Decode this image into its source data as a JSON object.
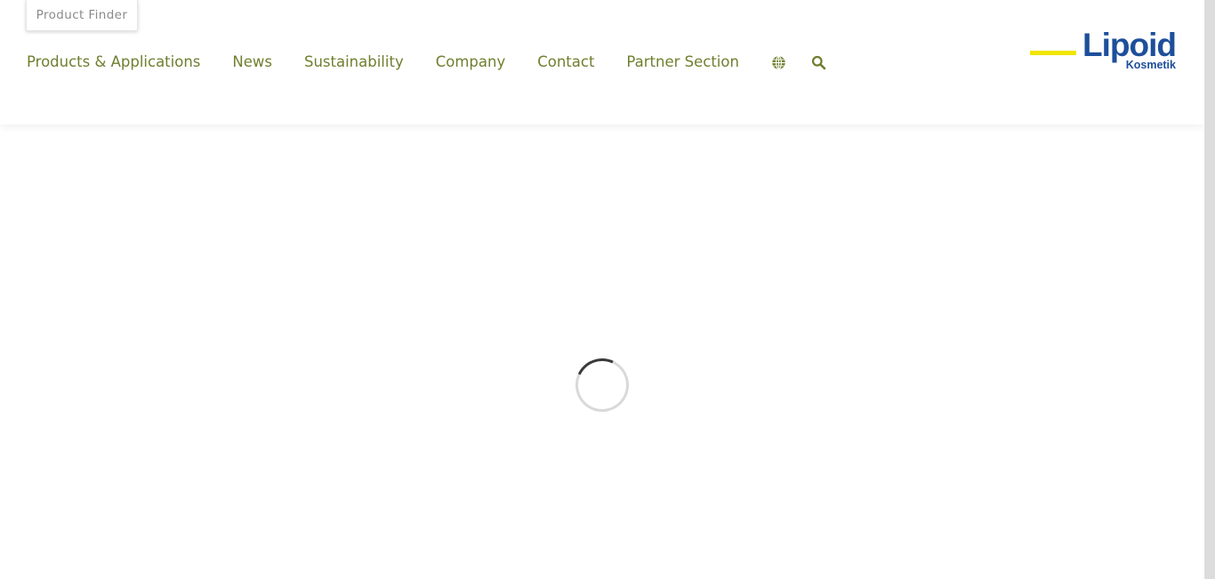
{
  "top_bar": {
    "product_finder_label": "Product Finder"
  },
  "nav": {
    "items": [
      {
        "label": "Products & Applications"
      },
      {
        "label": "News"
      },
      {
        "label": "Sustainability"
      },
      {
        "label": "Company"
      },
      {
        "label": "Contact"
      },
      {
        "label": "Partner Section"
      }
    ],
    "icons": [
      "globe-icon",
      "search-icon"
    ]
  },
  "logo": {
    "brand": "Lipoid",
    "subline": "Kosmetik",
    "brand_color": "#1d4f9a",
    "accent_color": "#f2e500"
  },
  "colors": {
    "nav_text": "#6f7f2e",
    "product_finder_text": "#8a8a8a",
    "spinner_active": "#3a3a3a",
    "spinner_track": "#d9d9d9"
  },
  "loading": {
    "spinner_icon": "loading-spinner-icon"
  }
}
